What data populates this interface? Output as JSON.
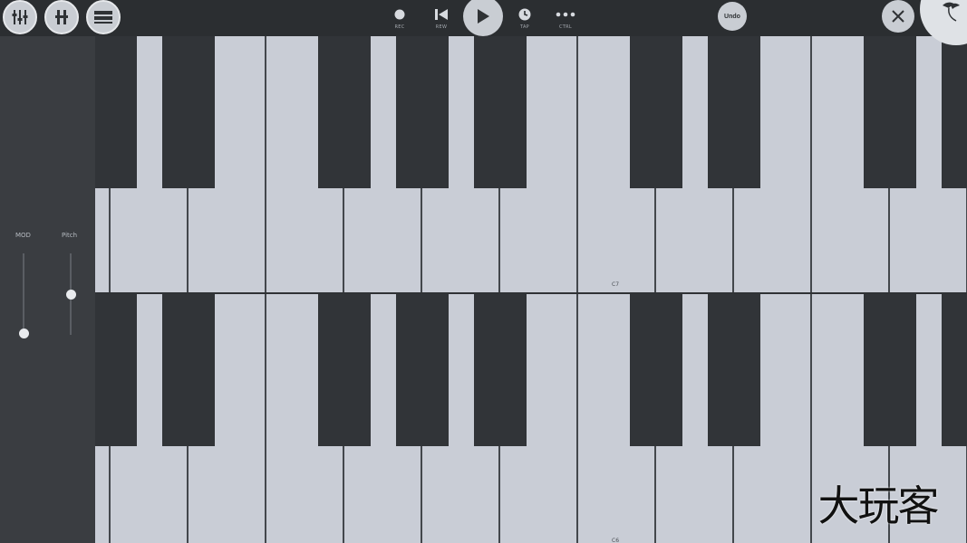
{
  "toolbar": {
    "left_buttons": [
      "mixer-icon",
      "channel-icon",
      "playlist-icon"
    ],
    "transport": [
      {
        "name": "record",
        "label": "REC",
        "icon": "record-icon"
      },
      {
        "name": "rewind",
        "label": "REW",
        "icon": "rewind-icon"
      },
      {
        "name": "tap",
        "label": "TAP",
        "icon": "tap-icon"
      },
      {
        "name": "control",
        "label": "CTRL",
        "icon": "more-icon"
      }
    ],
    "play_icon": "play-icon",
    "undo_label": "Undo",
    "close_icon": "close-icon",
    "logo_icon": "fl-fruit-logo-icon"
  },
  "sliders": {
    "mod": {
      "label": "MOD",
      "value": 0.0
    },
    "pitch": {
      "label": "Pitch",
      "value": 0.5
    }
  },
  "keyboard_top": {
    "octave_label": "C7"
  },
  "keyboard_bottom": {
    "octave_label": "C6"
  },
  "watermark": "大玩客",
  "colors": {
    "background": "#2f3235",
    "white_key": "#c9cdd6",
    "black_key": "#313438",
    "button": "#c9cdd3"
  }
}
